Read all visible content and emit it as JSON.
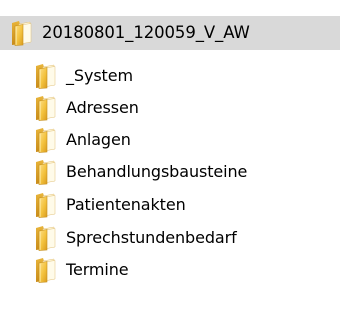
{
  "tree": {
    "root": {
      "label": "20180801_120059_V_AW",
      "icon": "folder-icon",
      "selected": true
    },
    "children": [
      {
        "label": "_System",
        "icon": "folder-icon"
      },
      {
        "label": "Adressen",
        "icon": "folder-icon"
      },
      {
        "label": "Anlagen",
        "icon": "folder-icon"
      },
      {
        "label": "Behandlungsbausteine",
        "icon": "folder-icon"
      },
      {
        "label": "Patientenakten",
        "icon": "folder-icon"
      },
      {
        "label": "Sprechstundenbedarf",
        "icon": "folder-icon"
      },
      {
        "label": "Termine",
        "icon": "folder-icon"
      }
    ]
  },
  "colors": {
    "selection_bg": "#d9d9d9",
    "folder_front": "#f3c23d",
    "folder_back": "#dca42b",
    "folder_paper": "#fff6d8"
  }
}
